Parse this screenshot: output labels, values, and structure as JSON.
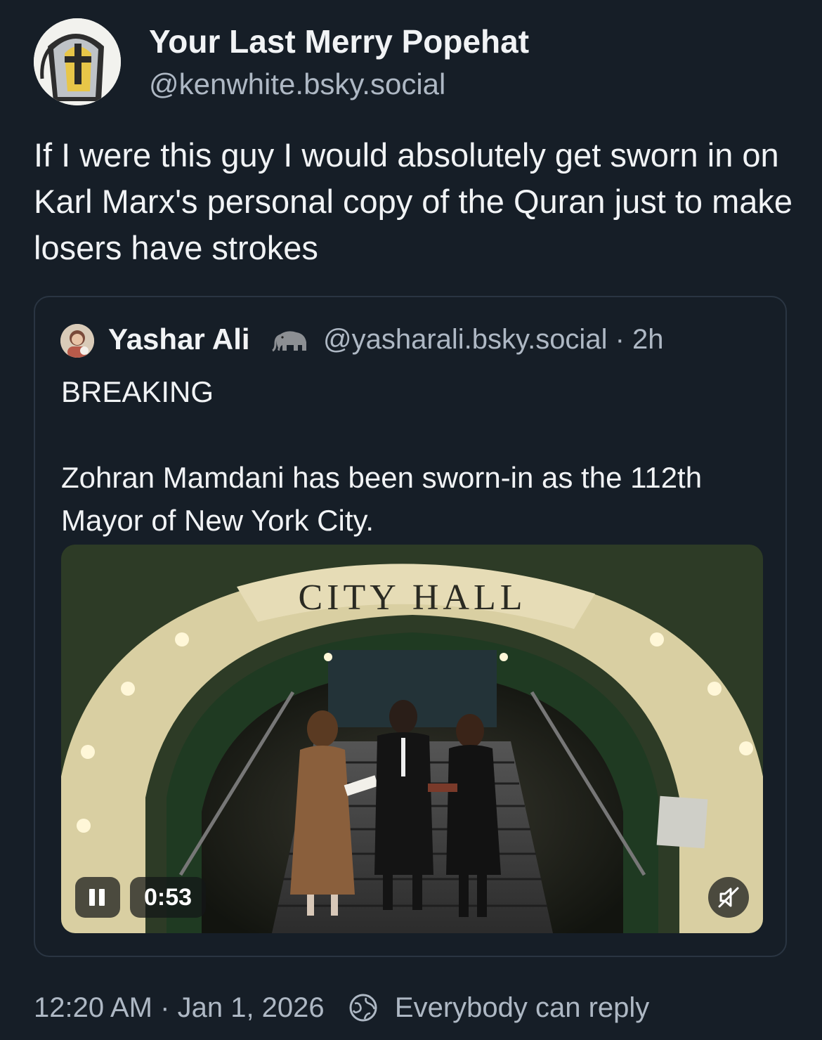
{
  "author": {
    "display_name": "Your Last Merry Popehat",
    "handle": "@kenwhite.bsky.social",
    "avatar_icon": "popehat-avatar-icon"
  },
  "post": {
    "text": "If I were this guy I would absolutely get sworn in on Karl Marx's personal copy of the Quran just to make losers have strokes"
  },
  "quoted_post": {
    "display_name": "Yashar Ali",
    "badge_icon": "elephant-icon",
    "handle": "@yasharali.bsky.social",
    "separator": "·",
    "age": "2h",
    "text_line1": "BREAKING",
    "text_line2": "Zohran Mamdani has been sworn-in as the 112th Mayor of New York City.",
    "video": {
      "sign_text": "CITY HALL",
      "time": "0:53",
      "pause_icon": "pause-icon",
      "mute_icon": "muted-speaker-icon"
    }
  },
  "footer": {
    "time": "12:20 AM",
    "separator": "·",
    "date": "Jan 1, 2026",
    "reply_icon": "globe-icon",
    "reply_setting": "Everybody can reply"
  },
  "colors": {
    "background": "#161e27",
    "text": "#f1f3f5",
    "muted": "#aeb8c4",
    "border": "#2a3542"
  }
}
